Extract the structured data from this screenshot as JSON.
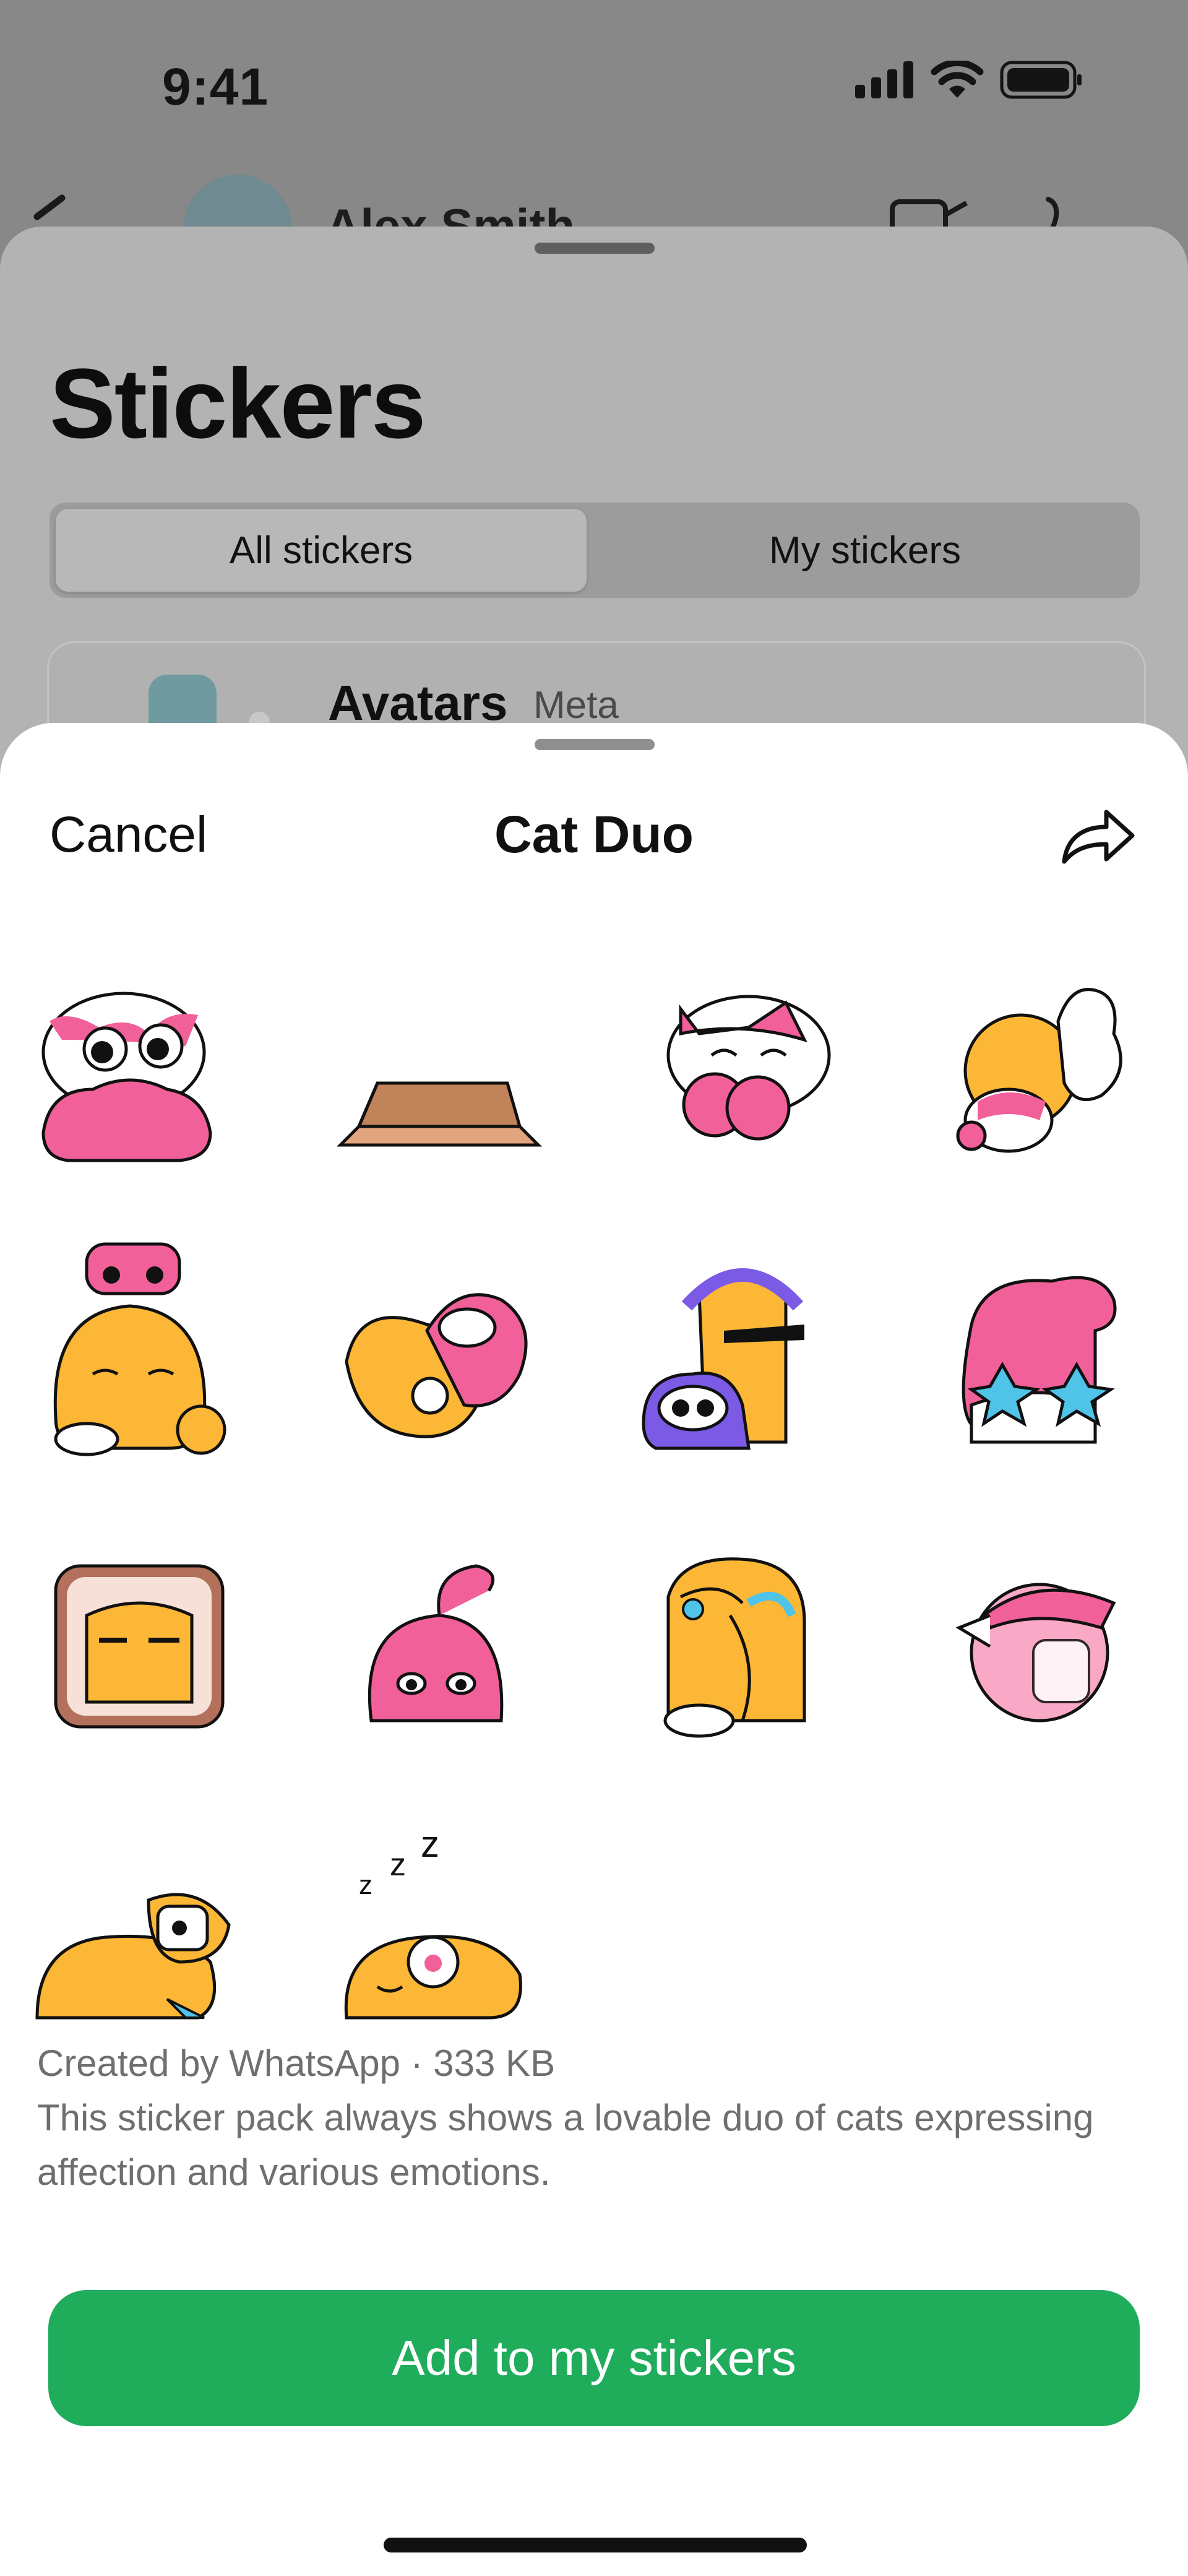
{
  "status_bar": {
    "time": "9:41"
  },
  "chat": {
    "contact_name": "Alex Smith"
  },
  "stickers_sheet": {
    "title": "Stickers",
    "tabs": [
      {
        "label": "All stickers",
        "selected": true
      },
      {
        "label": "My stickers",
        "selected": false
      }
    ],
    "packs": [
      {
        "name": "Avatars",
        "author": "Meta"
      }
    ]
  },
  "pack_sheet": {
    "cancel_label": "Cancel",
    "title": "Cat Duo",
    "sticker_count": 14,
    "info_line1": "Created by WhatsApp · 333 KB",
    "info_line2": "This sticker pack always shows a lovable duo of cats expressing affection and various emotions.",
    "add_button_label": "Add to my stickers"
  },
  "colors": {
    "accent_green": "#1FAD5C",
    "cat_pink": "#F2609A",
    "cat_orange": "#FBB735",
    "cat_purple": "#7B5BE6"
  }
}
